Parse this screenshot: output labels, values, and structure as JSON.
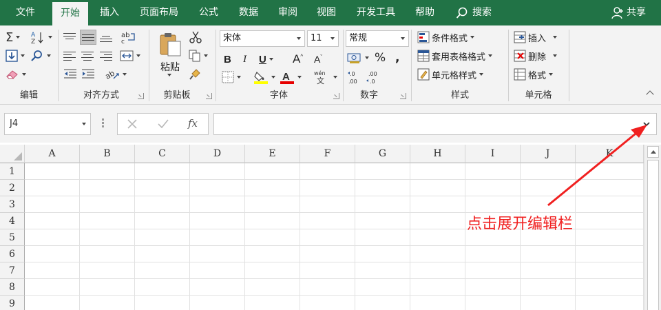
{
  "tabs": [
    {
      "label": "文件"
    },
    {
      "label": "开始"
    },
    {
      "label": "插入"
    },
    {
      "label": "页面布局"
    },
    {
      "label": "公式"
    },
    {
      "label": "数据"
    },
    {
      "label": "审阅"
    },
    {
      "label": "视图"
    },
    {
      "label": "开发工具"
    },
    {
      "label": "帮助"
    }
  ],
  "active_tab": "开始",
  "search_label": "搜索",
  "share_label": "共享",
  "ribbon": {
    "edit_group": {
      "label": "编辑"
    },
    "align_group": {
      "label": "对齐方式"
    },
    "clipboard_group": {
      "label": "剪贴板",
      "paste_label": "粘贴"
    },
    "font_group": {
      "label": "字体",
      "font_name": "宋体",
      "font_size": "11"
    },
    "number_group": {
      "label": "数字",
      "format": "常规"
    },
    "styles_group": {
      "label": "样式",
      "conditional_format": "条件格式",
      "table_format": "套用表格格式",
      "cell_styles": "单元格样式"
    },
    "cells_group": {
      "label": "单元格",
      "insert": "插入",
      "delete": "删除",
      "format": "格式"
    }
  },
  "formula_bar": {
    "name_box": "J4",
    "formula": ""
  },
  "columns": [
    "A",
    "B",
    "C",
    "D",
    "E",
    "F",
    "G",
    "H",
    "I",
    "J",
    "K"
  ],
  "rows": [
    "1",
    "2",
    "3",
    "4",
    "5",
    "6",
    "7",
    "8",
    "9"
  ],
  "annotation": "点击展开编辑栏",
  "colors": {
    "accent": "#217346",
    "annotation": "#f02020",
    "ribbon_bg": "#f3f3f3"
  }
}
